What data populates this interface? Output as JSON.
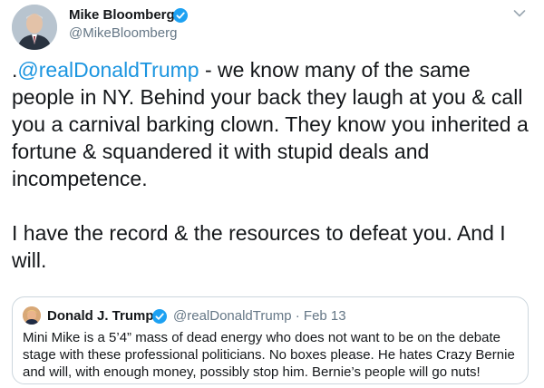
{
  "tweet": {
    "display_name": "Mike Bloomberg",
    "handle": "@MikeBloomberg",
    "text_prefix": ".",
    "mention": "@realDonaldTrump",
    "text_rest": " - we know many of the same people in NY. Behind your back they laugh at you & call you a carnival barking clown. They know you inherited a fortune & squandered it with stupid deals and incompetence.\n\nI have the record & the resources to defeat you. And I will."
  },
  "quoted_tweet": {
    "display_name": "Donald J. Trump",
    "handle": "@realDonaldTrump",
    "separator": "·",
    "date": "Feb 13",
    "text": "Mini Mike is a 5’4” mass of dead energy who does not want to be on the debate stage with these professional politicians. No boxes please. He hates Crazy Bernie and will, with enough money, possibly stop him. Bernie’s people will go nuts!"
  },
  "icons": {
    "verified": "verified-badge-icon",
    "more": "chevron-down-icon"
  },
  "colors": {
    "link": "#1b95e0",
    "verified": "#1da1f2",
    "secondary_text": "#657786",
    "border": "#ccd6dd"
  }
}
